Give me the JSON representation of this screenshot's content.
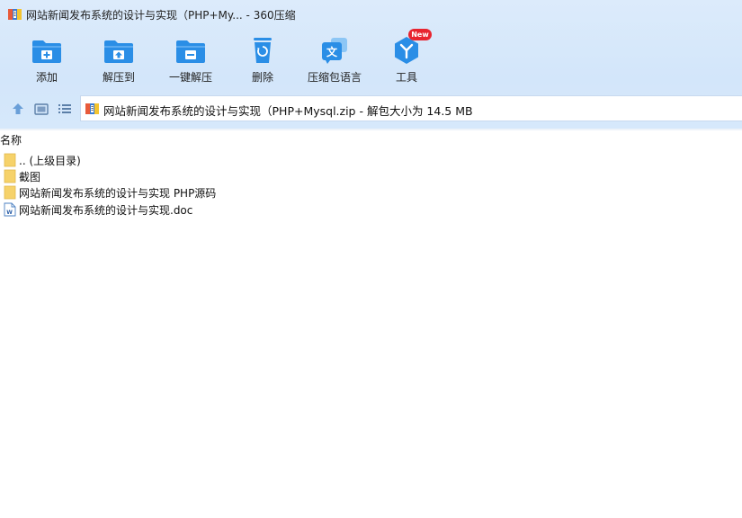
{
  "window": {
    "title": "网站新闻发布系统的设计与实现（PHP+My... - 360压缩"
  },
  "toolbar": {
    "items": [
      {
        "label": "添加",
        "icon": "add-folder-icon"
      },
      {
        "label": "解压到",
        "icon": "extract-folder-icon"
      },
      {
        "label": "一键解压",
        "icon": "one-click-extract-icon"
      },
      {
        "label": "删除",
        "icon": "recycle-bin-icon"
      },
      {
        "label": "压缩包语言",
        "icon": "language-icon"
      },
      {
        "label": "工具",
        "icon": "tools-icon"
      }
    ],
    "new_badge": "New"
  },
  "navbar": {
    "path": "网站新闻发布系统的设计与实现（PHP+Mysql.zip - 解包大小为 14.5 MB"
  },
  "list": {
    "column_name": "名称",
    "rows": [
      {
        "name": ".. (上级目录)",
        "type": "folder"
      },
      {
        "name": "截图",
        "type": "folder"
      },
      {
        "name": "网站新闻发布系统的设计与实现 PHP源码",
        "type": "folder"
      },
      {
        "name": "网站新闻发布系统的设计与实现.doc",
        "type": "doc"
      }
    ]
  },
  "colors": {
    "accent": "#2a8ee6",
    "header_bg": "#d6e8fb",
    "folder": "#f6d26a",
    "badge": "#e8242f"
  }
}
